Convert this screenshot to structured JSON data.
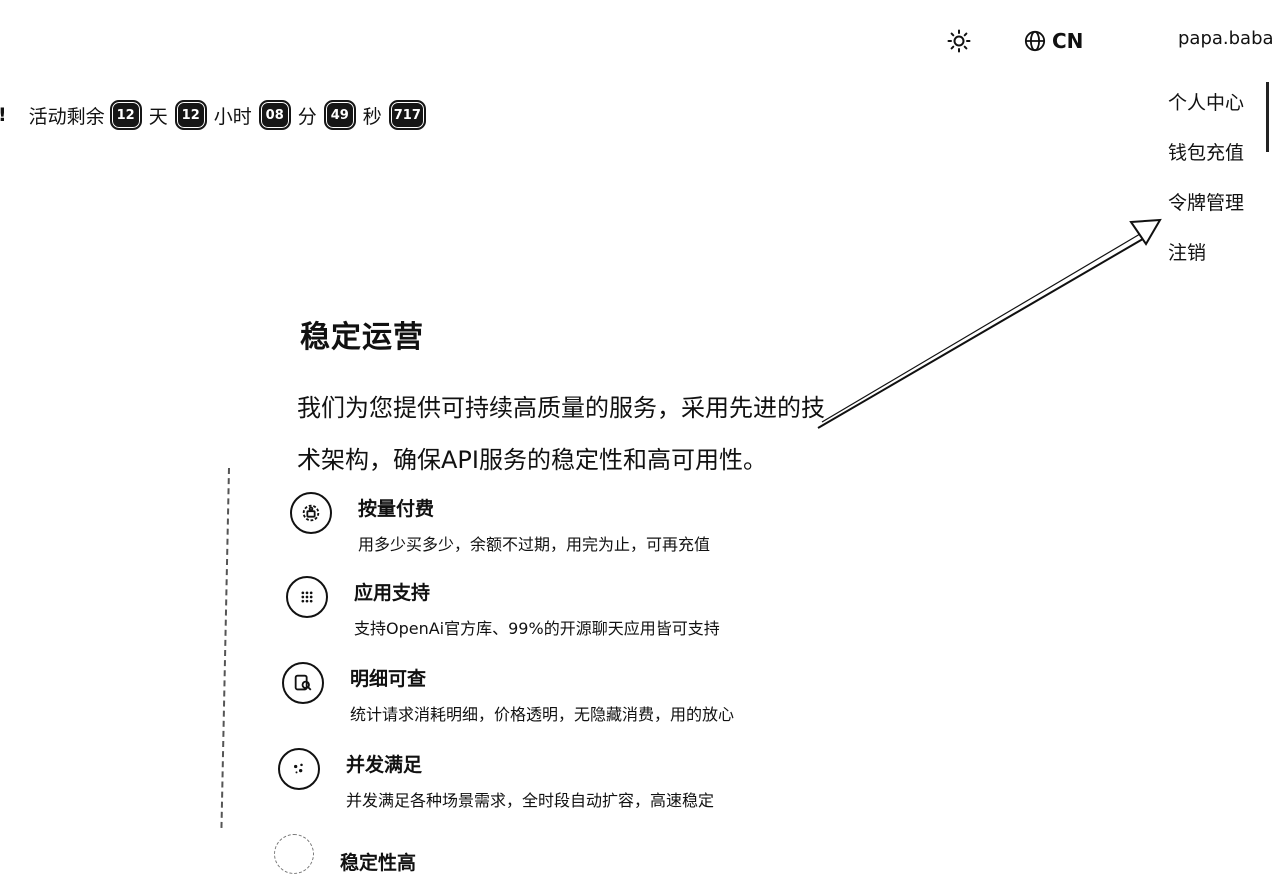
{
  "header": {
    "theme_icon": "sun-icon",
    "language": {
      "icon": "globe-icon",
      "label": "CN"
    },
    "user_name": "papa.baba"
  },
  "countdown": {
    "prefix": "!",
    "label": "活动剩余",
    "days": "12",
    "days_unit": "天",
    "hours": "12",
    "hours_unit": "小时",
    "minutes": "08",
    "minutes_unit": "分",
    "seconds": "49",
    "seconds_unit": "秒",
    "ms": "717"
  },
  "user_menu": {
    "items": [
      "个人中心",
      "钱包充值",
      "令牌管理",
      "注销"
    ]
  },
  "section": {
    "title": "稳定运营",
    "description_line1": "我们为您提供可持续高质量的服务，采用先进的技",
    "description_line2": "术架构，确保API服务的稳定性和高可用性。"
  },
  "features": [
    {
      "icon": "billing-icon",
      "title": "按量付费",
      "desc": "用多少买多少，余额不过期，用完为止，可再充值"
    },
    {
      "icon": "apps-grid-icon",
      "title": "应用支持",
      "desc": "支持OpenAi官方库、99%的开源聊天应用皆可支持"
    },
    {
      "icon": "search-detail-icon",
      "title": "明细可查",
      "desc": "统计请求消耗明细，价格透明，无隐藏消费，用的放心"
    },
    {
      "icon": "concurrency-icon",
      "title": "并发满足",
      "desc": "并发满足各种场景需求，全时段自动扩容，高速稳定"
    },
    {
      "icon": "stability-icon",
      "title": "稳定性高"
    }
  ]
}
